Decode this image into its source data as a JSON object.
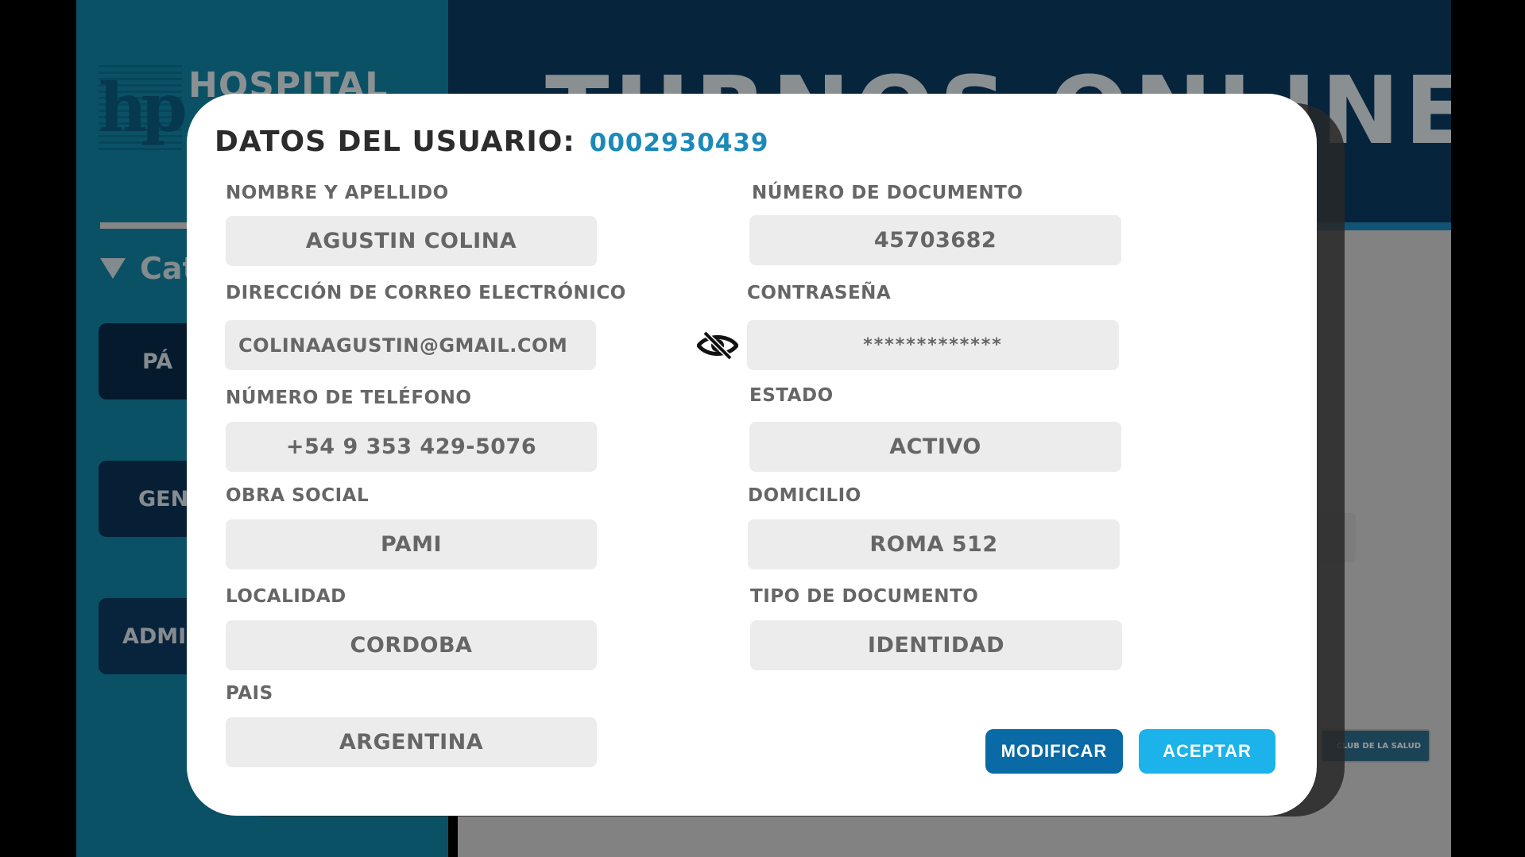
{
  "background": {
    "logo_text": "HOSPITAL",
    "hero_title": "TURNOS ONLINE",
    "sidebar_category": "Cat",
    "sidebar_buttons": [
      "PÁ",
      "GEN",
      "ADMI"
    ],
    "club_badge": "CLUB DE LA SALUD"
  },
  "modal": {
    "title": "DATOS DEL USUARIO:",
    "user_id": "0002930439",
    "fields": {
      "nombre": {
        "label": "NOMBRE Y APELLIDO",
        "value": "AGUSTIN COLINA"
      },
      "documento": {
        "label": "NÚMERO DE DOCUMENTO",
        "value": "45703682"
      },
      "email": {
        "label": "DIRECCIÓN DE CORREO ELECTRÓNICO",
        "value": "COLINAAGUSTIN@GMAIL.COM"
      },
      "password": {
        "label": "CONTRASEÑA",
        "value": "*************"
      },
      "telefono": {
        "label": "NÚMERO DE TELÉFONO",
        "value": "+54 9 353 429-5076"
      },
      "estado": {
        "label": "ESTADO",
        "value": "ACTIVO"
      },
      "obra_social": {
        "label": "OBRA SOCIAL",
        "value": "PAMI"
      },
      "domicilio": {
        "label": "DOMICILIO",
        "value": "ROMA 512"
      },
      "localidad": {
        "label": "LOCALIDAD",
        "value": "CORDOBA"
      },
      "tipo_documento": {
        "label": "TIPO DE DOCUMENTO",
        "value": "IDENTIDAD"
      },
      "pais": {
        "label": "PAIS",
        "value": "ARGENTINA"
      }
    },
    "buttons": {
      "modificar": "MODIFICAR",
      "aceptar": "ACEPTAR"
    },
    "password_toggle_icon": "eye-slash-icon"
  },
  "colors": {
    "accent": "#1a8ab8",
    "primary_button": "#0a6aa5",
    "secondary_button": "#1cb2ea",
    "sidebar": "#1188a8",
    "hero": "#0a3c64"
  }
}
